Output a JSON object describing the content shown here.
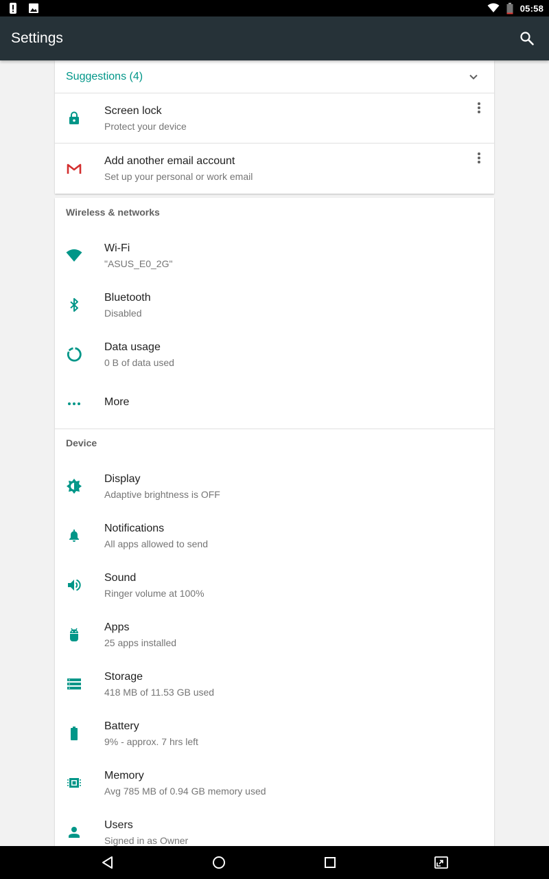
{
  "status_bar": {
    "time": "05:58",
    "left_icons": [
      "alert-icon",
      "image-icon"
    ],
    "right_icons": [
      "wifi-icon",
      "battery-icon"
    ]
  },
  "app_bar": {
    "title": "Settings",
    "search_icon": "search-icon"
  },
  "suggestions": {
    "title": "Suggestions (4)",
    "items": [
      {
        "icon": "lock-icon",
        "title": "Screen lock",
        "subtitle": "Protect your device"
      },
      {
        "icon": "gmail-icon",
        "title": "Add another email account",
        "subtitle": "Set up your personal or work email"
      }
    ]
  },
  "sections": [
    {
      "header": "Wireless & networks",
      "items": [
        {
          "icon": "wifi-icon",
          "title": "Wi-Fi",
          "subtitle": "\"ASUS_E0_2G\""
        },
        {
          "icon": "bluetooth-icon",
          "title": "Bluetooth",
          "subtitle": "Disabled"
        },
        {
          "icon": "data-usage-icon",
          "title": "Data usage",
          "subtitle": "0 B of data used"
        },
        {
          "icon": "more-icon",
          "title": "More",
          "subtitle": ""
        }
      ]
    },
    {
      "header": "Device",
      "items": [
        {
          "icon": "brightness-icon",
          "title": "Display",
          "subtitle": "Adaptive brightness is OFF"
        },
        {
          "icon": "bell-icon",
          "title": "Notifications",
          "subtitle": "All apps allowed to send"
        },
        {
          "icon": "volume-icon",
          "title": "Sound",
          "subtitle": "Ringer volume at 100%"
        },
        {
          "icon": "android-icon",
          "title": "Apps",
          "subtitle": "25 apps installed"
        },
        {
          "icon": "storage-icon",
          "title": "Storage",
          "subtitle": "418 MB of 11.53 GB used"
        },
        {
          "icon": "battery-icon",
          "title": "Battery",
          "subtitle": "9% - approx. 7 hrs left"
        },
        {
          "icon": "memory-icon",
          "title": "Memory",
          "subtitle": "Avg 785 MB of 0.94 GB memory used"
        },
        {
          "icon": "person-icon",
          "title": "Users",
          "subtitle": "Signed in as Owner"
        }
      ]
    }
  ],
  "nav_bar": {
    "buttons": [
      "back-icon",
      "home-icon",
      "recents-icon",
      "screenshot-icon"
    ]
  },
  "colors": {
    "accent": "#009688",
    "app_bar": "#263238",
    "background": "#f2f2f2"
  }
}
